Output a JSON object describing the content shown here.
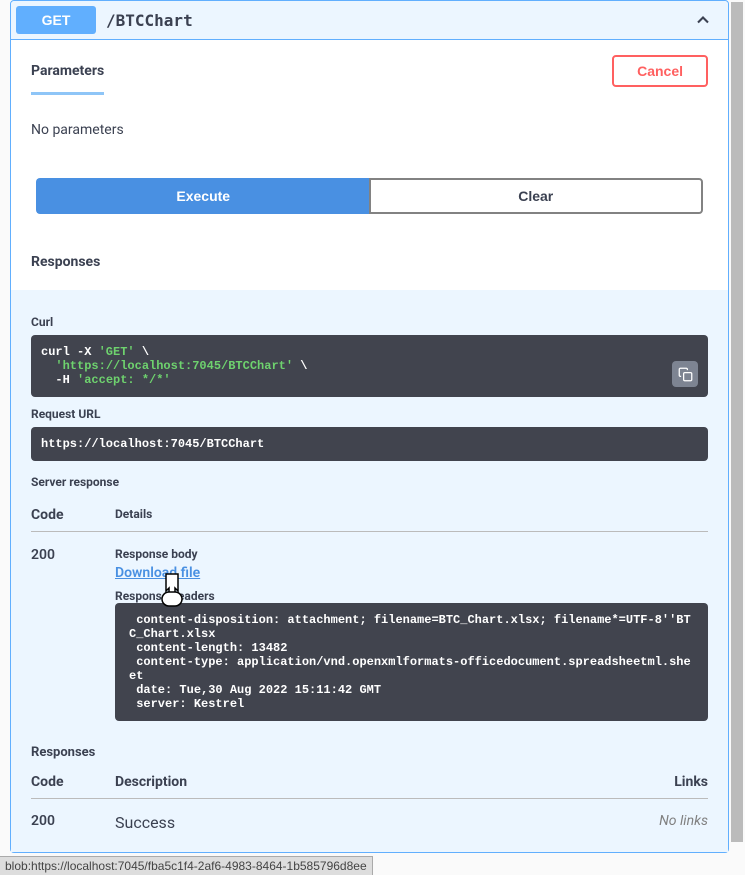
{
  "opblock": {
    "method": "GET",
    "path": "/BTCChart"
  },
  "parameters": {
    "tab_label": "Parameters",
    "cancel_label": "Cancel",
    "empty_text": "No parameters"
  },
  "buttons": {
    "execute": "Execute",
    "clear": "Clear"
  },
  "responses": {
    "header": "Responses",
    "curl_label": "Curl",
    "curl_prefix": "curl -X ",
    "curl_method": "'GET'",
    "curl_bs": " \\",
    "curl_url": "'https://localhost:7045/BTCChart'",
    "curl_h": "  -H ",
    "curl_accept": "'accept: */*'",
    "request_url_label": "Request URL",
    "request_url": "https://localhost:7045/BTCChart",
    "server_response_label": "Server response",
    "code_header": "Code",
    "details_header": "Details",
    "code_value": "200",
    "response_body_label": "Response body",
    "download_label": "Download file",
    "response_headers_label": "Response headers",
    "headers_text": " content-disposition: attachment; filename=BTC_Chart.xlsx; filename*=UTF-8''BTC_Chart.xlsx \n content-length: 13482 \n content-type: application/vnd.openxmlformats-officedocument.spreadsheetml.sheet \n date: Tue,30 Aug 2022 15:11:42 GMT \n server: Kestrel ",
    "responses2_label": "Responses",
    "description_header": "Description",
    "links_header": "Links",
    "code2_value": "200",
    "success_text": "Success",
    "nolinks_text": "No links"
  },
  "status_bar": "blob:https://localhost:7045/fba5c1f4-2af6-4983-8464-1b585796d8ee"
}
